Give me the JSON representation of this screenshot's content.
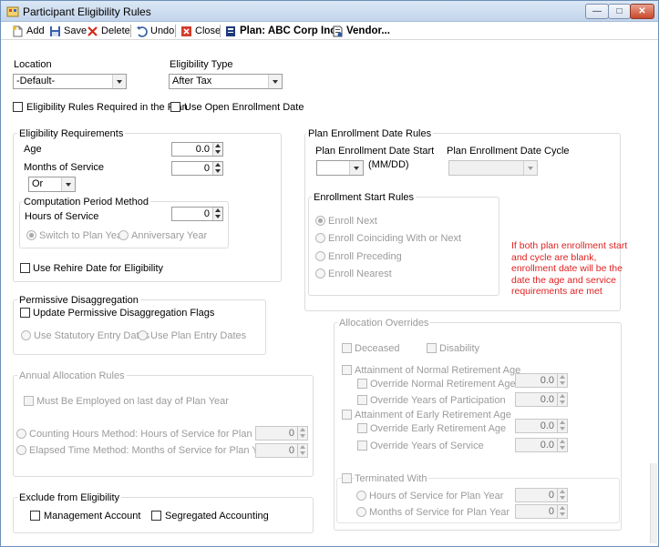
{
  "window": {
    "title": "Participant Eligibility Rules"
  },
  "toolbar": {
    "add": "Add",
    "save": "Save",
    "delete": "Delete",
    "undo": "Undo",
    "close": "Close",
    "plan": "Plan: ABC Corp Inc",
    "vendor": "Vendor..."
  },
  "location": {
    "label": "Location",
    "value": "-Default-"
  },
  "eligibility_type": {
    "label": "Eligibility Type",
    "value": "After Tax"
  },
  "rules_required_label": "Eligibility Rules Required in the Plan",
  "open_enrollment_label": "Use Open Enrollment Date",
  "requirements": {
    "title": "Eligibility Requirements",
    "age_label": "Age",
    "age_value": "0.0",
    "months_label": "Months of Service",
    "months_value": "0",
    "andor_value": "Or",
    "computation": {
      "title": "Computation Period Method",
      "hours_label": "Hours of Service",
      "hours_value": "0",
      "switch_label": "Switch to Plan Year",
      "anniversary_label": "Anniversary Year"
    },
    "rehire_label": "Use Rehire Date for Eligibility"
  },
  "permissive": {
    "title": "Permissive Disaggregation",
    "update_label": "Update Permissive Disaggregation Flags",
    "statutory_label": "Use Statutory Entry Dates",
    "plan_entry_label": "Use Plan Entry Dates"
  },
  "annual": {
    "title": "Annual Allocation Rules",
    "employed_label": "Must Be Employed on last day of Plan Year",
    "counting_label": "Counting Hours Method:  Hours of Service for Plan Year",
    "counting_value": "0",
    "elapsed_label": "Elapsed Time Method: Months of Service for Plan Year",
    "elapsed_value": "0"
  },
  "exclude": {
    "title": "Exclude from Eligibility",
    "management_label": "Management Account",
    "segregated_label": "Segregated Accounting"
  },
  "plan_enrollment": {
    "title": "Plan Enrollment Date Rules",
    "start_label": "Plan Enrollment Date Start",
    "format_label": "(MM/DD)",
    "cycle_label": "Plan Enrollment Date Cycle",
    "start_rules": {
      "title": "Enrollment Start Rules",
      "next": "Enroll Next",
      "coinciding": "Enroll Coinciding With or Next",
      "preceding": "Enroll Preceding",
      "nearest": "Enroll Nearest"
    },
    "note": "If both plan enrollment start and cycle are blank, enrollment date will be the date the age and service requirements are met"
  },
  "allocation": {
    "title": "Allocation Overrides",
    "deceased": "Deceased",
    "disability": "Disability",
    "normal_ret": "Attainment of Normal Retirement Age",
    "override_normal_age": "Override Normal Retirement Age",
    "override_normal_age_value": "0.0",
    "override_participation": "Override Years of Participation",
    "override_participation_value": "0.0",
    "early_ret": "Attainment of Early Retirement Age",
    "override_early_age": "Override Early Retirement Age",
    "override_early_age_value": "0.0",
    "override_service": "Override Years of Service",
    "override_service_value": "0.0",
    "terminated": "Terminated With",
    "hours_plan_year": "Hours of Service for Plan Year",
    "hours_plan_year_value": "0",
    "months_plan_year": "Months of Service for Plan Year",
    "months_plan_year_value": "0"
  }
}
